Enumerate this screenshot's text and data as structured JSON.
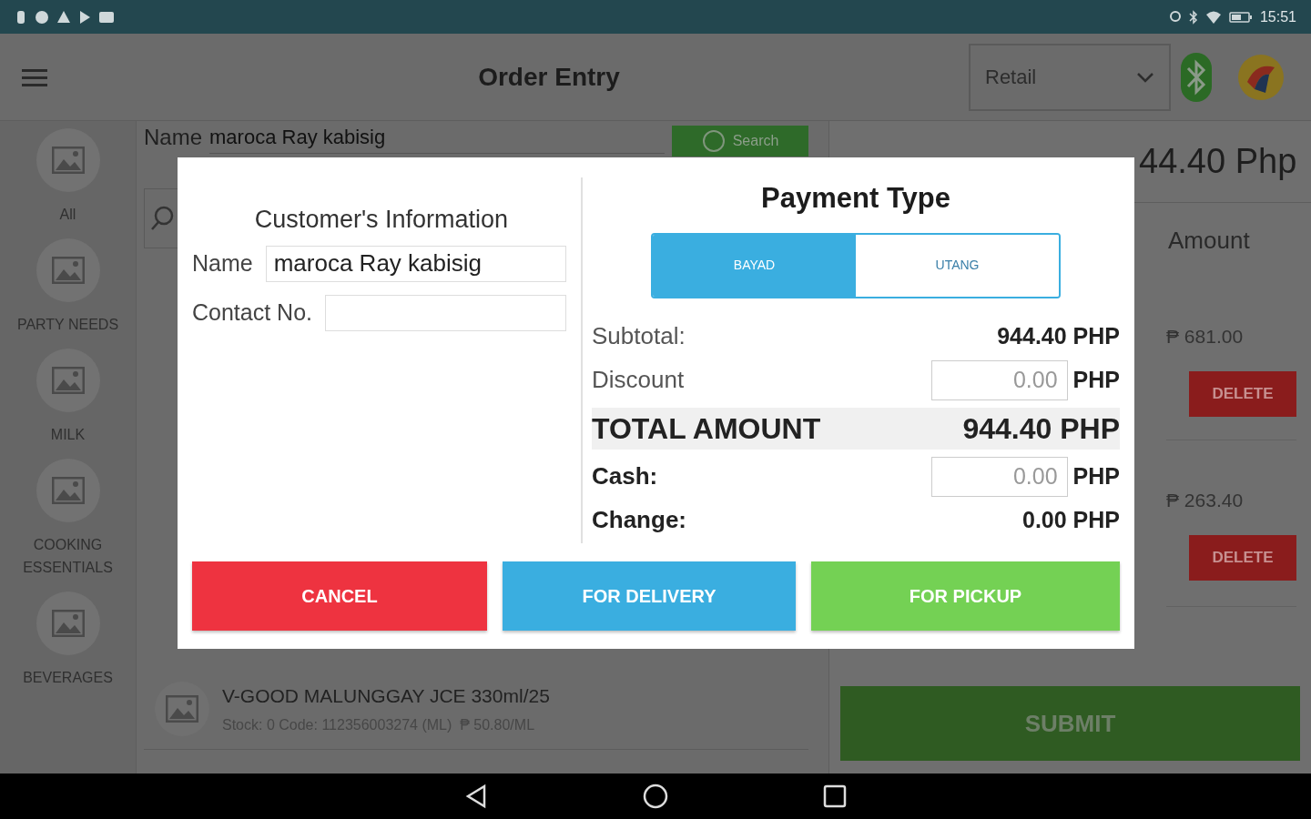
{
  "status_bar": {
    "time": "15:51"
  },
  "app_bar": {
    "title": "Order Entry",
    "price_type": "Retail"
  },
  "categories": [
    {
      "label": "All"
    },
    {
      "label": "PARTY NEEDS"
    },
    {
      "label": "MILK"
    },
    {
      "label": "COOKING ESSENTIALS"
    },
    {
      "label": "BEVERAGES"
    }
  ],
  "search": {
    "label": "Name",
    "value": "maroca Ray kabisig",
    "button": "Search"
  },
  "products": [
    {
      "name": "V-GOOD MALUNGGAY JCE 330ml/25",
      "details": "Stock: 0 Code: 112356003274 (ML)  ₱ 50.80/ML"
    }
  ],
  "cart": {
    "total": "44.40 Php",
    "column": "Amount",
    "items": [
      {
        "amount": "₱ 681.00",
        "action": "DELETE"
      },
      {
        "amount": "₱ 263.40",
        "action": "DELETE"
      }
    ],
    "submit": "SUBMIT"
  },
  "dialog": {
    "customer": {
      "title": "Customer's Information",
      "fields": [
        {
          "label": "Name",
          "value": "maroca Ray kabisig"
        },
        {
          "label": "Contact No."
        }
      ]
    },
    "payment": {
      "title": "Payment Type",
      "options": [
        {
          "label": "BAYAD",
          "selected": true
        },
        {
          "label": "UTANG",
          "selected": false
        }
      ],
      "rows": [
        {
          "kind": "text",
          "label": "Subtotal:",
          "bold": false,
          "value": "944.40",
          "unit": "PHP"
        },
        {
          "kind": "input",
          "label": "Discount",
          "bold": false,
          "placeholder": "0.00",
          "unit": "PHP"
        },
        {
          "kind": "total",
          "label": "TOTAL AMOUNT",
          "bold": true,
          "value": "944.40",
          "unit": "PHP"
        },
        {
          "kind": "input",
          "label": "Cash:",
          "bold": true,
          "placeholder": "0.00",
          "unit": "PHP"
        },
        {
          "kind": "text",
          "label": "Change:",
          "bold": true,
          "value": "0.00",
          "unit": "PHP"
        }
      ]
    },
    "buttons": [
      {
        "label": "CANCEL",
        "kind": "cancel"
      },
      {
        "label": "FOR DELIVERY",
        "kind": "delivery"
      },
      {
        "label": "FOR PICKUP",
        "kind": "pickup"
      }
    ]
  }
}
